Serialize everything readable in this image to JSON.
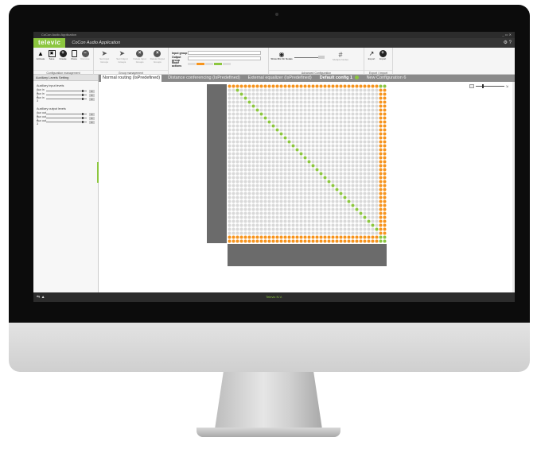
{
  "window": {
    "title": "CoCon Audio Application",
    "controls": "_ ▭ ✕"
  },
  "appbar": {
    "brand": "televic",
    "title": "CoCon Audio Application",
    "tools": "⚙ ?"
  },
  "ribbon": {
    "config_group": {
      "title": "Configuration management",
      "buttons": [
        {
          "label": "Activate",
          "icon": "activate-icon"
        },
        {
          "label": "Save",
          "icon": "save-icon"
        },
        {
          "label": "Create",
          "icon": "plus-circle-icon"
        },
        {
          "label": "Clone",
          "icon": "clone-icon"
        },
        {
          "label": "Remove",
          "icon": "minus-circle-icon"
        }
      ]
    },
    "group_group": {
      "title": "Group management",
      "buttons": [
        {
          "label": "Set Input Groups",
          "icon": "forward-arrow-icon"
        },
        {
          "label": "Set Output Groups",
          "icon": "forward-arrow-icon"
        },
        {
          "label": "Delete Input Groups",
          "icon": "close-circle-icon"
        },
        {
          "label": "Delete Output Groups",
          "icon": "close-circle-icon"
        }
      ]
    },
    "io": {
      "input_label": "Input group",
      "output_label": "Output group",
      "mode_label": "Mode actions"
    },
    "advanced": {
      "show_mix_label": "Show Mix On Nodes",
      "multiple_nodes_label": "Multiple Nodes",
      "title": "Advanced Configuration"
    },
    "export_group": {
      "title": "Export / Import",
      "export_label": "Export",
      "import_label": "Import"
    }
  },
  "left_panel": {
    "header": "Auxiliary Levels Setting",
    "input_title": "Auxiliary input levels",
    "inputs": [
      {
        "name": "Aux in 1",
        "value": "0"
      },
      {
        "name": "Aux in 2",
        "value": "0"
      },
      {
        "name": "Aux in 3",
        "value": "0"
      }
    ],
    "output_title": "Auxiliary output levels",
    "outputs": [
      {
        "name": "Aux out 1",
        "value": "0"
      },
      {
        "name": "Aux out 2",
        "value": "0"
      },
      {
        "name": "Aux out 3",
        "value": "0"
      }
    ]
  },
  "tabs": [
    {
      "label": "Normal routing (IsPredefined)",
      "state": "active"
    },
    {
      "label": "Distance conferencing (IsPredefined)",
      "state": "normal"
    },
    {
      "label": "External equalizer (IsPredefined)",
      "state": "normal"
    },
    {
      "label": "Default config 1",
      "state": "bold"
    },
    {
      "label": "New Configuration 6",
      "state": "normal"
    }
  ],
  "matrix": {
    "rows": 40,
    "cols": 40,
    "colors": {
      "inactive": "#d9d9d9",
      "orange": "#f7941d",
      "green": "#8cc63f",
      "label_bg": "#6b6b6b"
    }
  },
  "status": {
    "text": "Televic N.V.",
    "left_icons": "⇆ ▲"
  }
}
